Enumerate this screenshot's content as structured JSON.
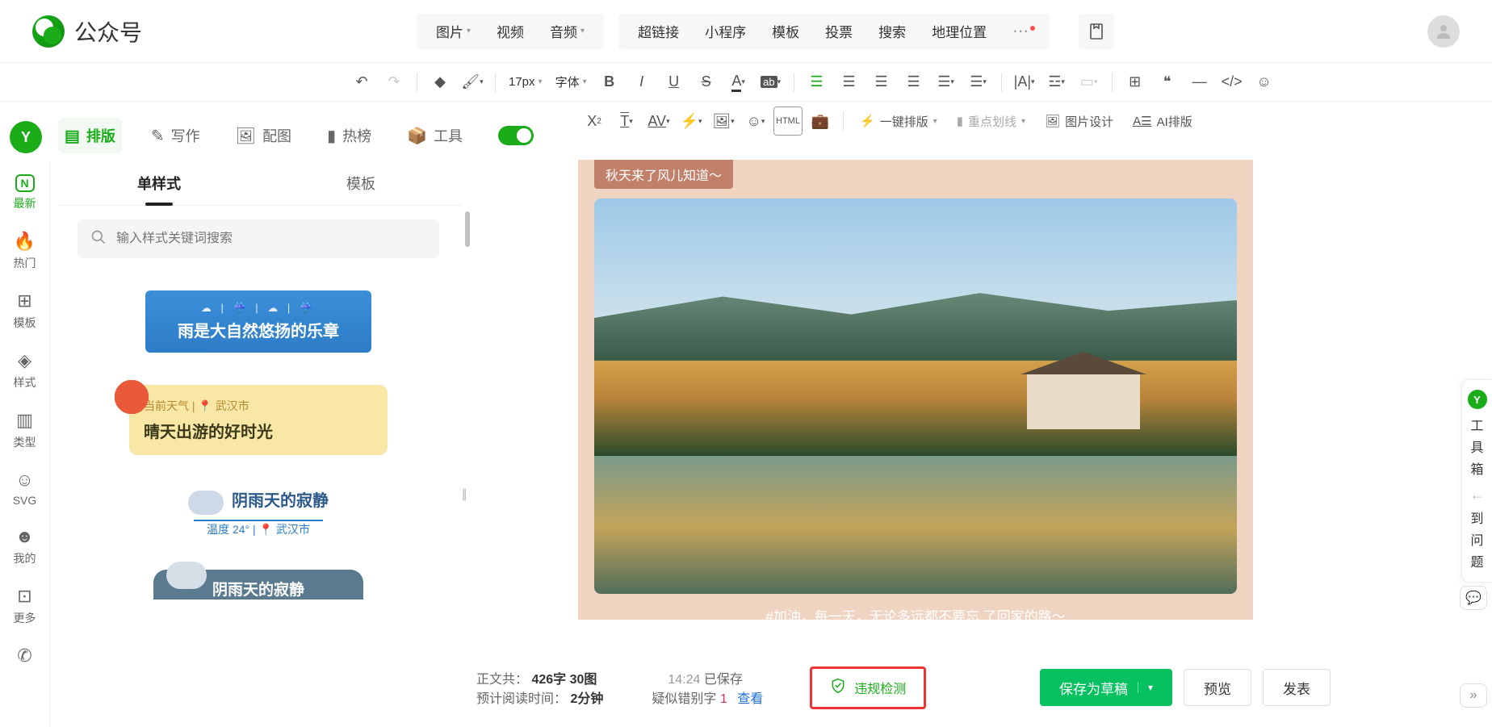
{
  "header": {
    "app_title": "公众号",
    "menu1": [
      "图片",
      "视频",
      "音频"
    ],
    "menu2": [
      "超链接",
      "小程序",
      "模板",
      "投票",
      "搜索",
      "地理位置"
    ],
    "more": "⋯"
  },
  "toolbar1": {
    "font_size": "17px",
    "font_family": "字体"
  },
  "toolbar2": {
    "one_click": "一键排版",
    "underline": "重点划线",
    "image_design": "图片设计",
    "ai_layout": "AI排版"
  },
  "editor_tabs": {
    "layout": "排版",
    "write": "写作",
    "image": "配图",
    "hot": "热榜",
    "tool": "工具"
  },
  "rail": {
    "items": [
      {
        "icon": "N",
        "label": "最新"
      },
      {
        "icon": "🔥",
        "label": "热门"
      },
      {
        "icon": "⊞",
        "label": "模板"
      },
      {
        "icon": "◈",
        "label": "样式"
      },
      {
        "icon": "▥",
        "label": "类型"
      },
      {
        "icon": "☺",
        "label": "SVG"
      },
      {
        "icon": "☻",
        "label": "我的"
      },
      {
        "icon": "⊡",
        "label": "更多"
      },
      {
        "icon": "✆",
        "label": ""
      }
    ]
  },
  "subtabs": {
    "t1": "单样式",
    "t2": "模板"
  },
  "search": {
    "placeholder": "输入样式关键词搜索"
  },
  "cards": {
    "c1": {
      "icons": "☁ | ☔ | ☁ | ☔",
      "text": "雨是大自然悠扬的乐章"
    },
    "c2": {
      "row1": "当前天气 | 📍 武汉市",
      "row2": "晴天出游的好时光"
    },
    "c3": {
      "t1": "阴雨天的寂静",
      "t2": "温度 24° | 📍 武汉市"
    },
    "c4": {
      "t": "阴雨天的寂静"
    }
  },
  "canvas": {
    "tag": "秋天来了风儿知道～",
    "caption": "#加油，每一天，无论多远都不要忘 了回家的路～"
  },
  "status": {
    "text_count_label": "正文共：",
    "text_count": "426字 30图",
    "read_time_label": "预计阅读时间：",
    "read_time": "2分钟",
    "time": "14:24",
    "saved": "已保存",
    "typo_label": "疑似错别字",
    "typo_count": "1",
    "view": "查看",
    "violate": "违规检测",
    "save_draft": "保存为草稿",
    "preview": "预览",
    "publish": "发表"
  },
  "right": {
    "toolbox": "工具箱",
    "question": "到问题"
  }
}
